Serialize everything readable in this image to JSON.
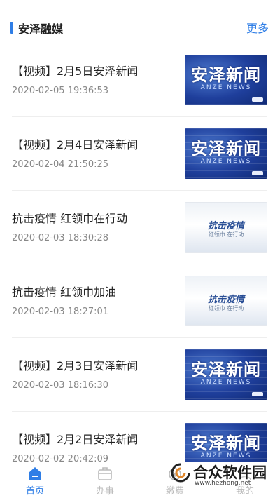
{
  "header": {
    "title": "安泽融媒",
    "more": "更多"
  },
  "news": [
    {
      "title": "【视频】2月5日安泽新闻",
      "date": "2020-02-05 19:36:53",
      "thumb_type": "news",
      "thumb_big": "安泽新闻",
      "thumb_small": "ANZE NEWS"
    },
    {
      "title": "【视频】2月4日安泽新闻",
      "date": "2020-02-04 21:50:25",
      "thumb_type": "news",
      "thumb_big": "安泽新闻",
      "thumb_small": "ANZE NEWS"
    },
    {
      "title": "抗击疫情 红领巾在行动",
      "date": "2020-02-03 18:30:28",
      "thumb_type": "poster",
      "thumb_big": "抗击疫情",
      "thumb_small": "红领巾 在行动"
    },
    {
      "title": "抗击疫情 红领巾加油",
      "date": "2020-02-03 18:27:01",
      "thumb_type": "poster",
      "thumb_big": "抗击疫情",
      "thumb_small": "红领巾 在行动"
    },
    {
      "title": "【视频】2月3日安泽新闻",
      "date": "2020-02-03 18:16:30",
      "thumb_type": "news",
      "thumb_big": "安泽新闻",
      "thumb_small": "ANZE NEWS"
    },
    {
      "title": "【视频】2月2日安泽新闻",
      "date": "2020-02-02 20:42:09",
      "thumb_type": "news",
      "thumb_big": "安泽新闻",
      "thumb_small": "ANZE NEWS"
    }
  ],
  "tabs": [
    {
      "label": "首页",
      "icon": "home-icon",
      "active": true
    },
    {
      "label": "办事",
      "icon": "briefcase-icon",
      "active": false
    },
    {
      "label": "缴费",
      "icon": "payment-icon",
      "active": false
    },
    {
      "label": "我的",
      "icon": "user-icon",
      "active": false
    }
  ],
  "watermark": {
    "text": "合众软件园",
    "url": "www.hezhong.net"
  },
  "colors": {
    "accent": "#2f7ee6",
    "inactive": "#bbbbbb"
  }
}
